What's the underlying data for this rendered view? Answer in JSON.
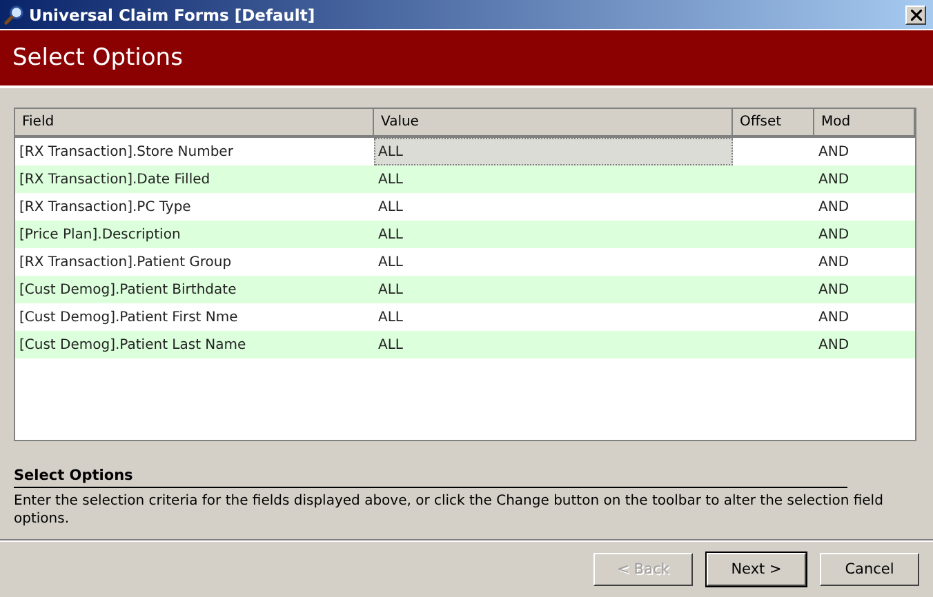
{
  "window": {
    "title": "Universal Claim Forms [Default]"
  },
  "header": {
    "title": "Select Options"
  },
  "table": {
    "columns": [
      "Field",
      "Value",
      "Offset",
      "Mod"
    ],
    "rows": [
      {
        "field": "[RX Transaction].Store Number",
        "value": "ALL",
        "mod": "AND",
        "selected": true
      },
      {
        "field": "[RX Transaction].Date Filled",
        "value": "ALL",
        "mod": "AND",
        "selected": false
      },
      {
        "field": "[RX Transaction].PC Type",
        "value": "ALL",
        "mod": "AND",
        "selected": false
      },
      {
        "field": "[Price Plan].Description",
        "value": "ALL",
        "mod": "AND",
        "selected": false
      },
      {
        "field": "[RX Transaction].Patient Group",
        "value": "ALL",
        "mod": "AND",
        "selected": false
      },
      {
        "field": "[Cust Demog].Patient Birthdate",
        "value": "ALL",
        "mod": "AND",
        "selected": false
      },
      {
        "field": "[Cust Demog].Patient First Nme",
        "value": "ALL",
        "mod": "AND",
        "selected": false
      },
      {
        "field": "[Cust Demog].Patient Last Name",
        "value": "ALL",
        "mod": "AND",
        "selected": false
      }
    ]
  },
  "help": {
    "title": "Select Options",
    "text": "Enter the selection criteria for the fields displayed above, or click the Change button on the toolbar to alter the selection field options."
  },
  "buttons": [
    {
      "label": "< Back",
      "disabled": true,
      "default": false
    },
    {
      "label": "Next >",
      "disabled": false,
      "default": true
    },
    {
      "label": "Cancel",
      "disabled": false,
      "default": false
    }
  ]
}
